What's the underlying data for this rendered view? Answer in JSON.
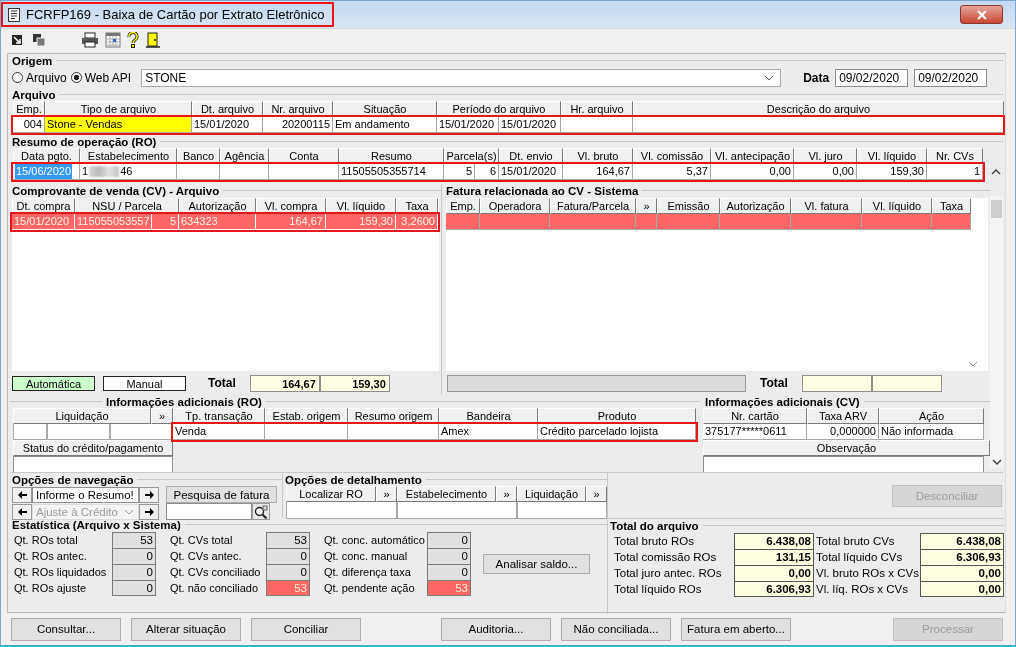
{
  "window": {
    "title": "FCRFP169 - Baixa de Cartão por Extrato Eletrônico",
    "annotated": true
  },
  "origem": {
    "legend": "Origem",
    "modes": [
      {
        "label": "Arquivo",
        "selected": false
      },
      {
        "label": "Web API",
        "selected": true
      }
    ],
    "operator": "STONE",
    "date_label": "Data",
    "date_from": "09/02/2020",
    "date_to": "09/02/2020"
  },
  "arquivo": {
    "legend": "Arquivo",
    "columns": [
      "Emp.",
      "Tipo de arquivo",
      "Dt. arquivo",
      "Nr. arquivo",
      "Situação",
      "Período do arquivo",
      "Hr. arquivo",
      "Descrição do arquivo"
    ],
    "rows": [
      {
        "annotated": true,
        "cells": [
          "004",
          {
            "text": "Stone - Vendas",
            "color": "#ffff00"
          },
          "15/01/2020",
          "20200115",
          "Em andamento",
          {
            "parts": [
              "15/01/2020",
              "15/01/2020"
            ]
          },
          null,
          null
        ]
      }
    ]
  },
  "resumo": {
    "legend": "Resumo de operação (RO)",
    "columns": [
      "Data pgto.",
      "Estabelecimento",
      "Banco",
      "Agência",
      "Conta",
      "Resumo",
      "Parcela(s)",
      "Dt. envio",
      "Vl. bruto",
      "Vl. comissão",
      "Vl. antecipação",
      "Vl. juro",
      "Vl. líquido",
      "Nr. CVs"
    ],
    "rows": [
      {
        "annotated": true,
        "cells": [
          {
            "text": "15/06/2020",
            "text_selected": true
          },
          {
            "kind": "redacted",
            "start": "1",
            "end": "46"
          },
          null,
          null,
          null,
          "11505505355714",
          {
            "parts": [
              "5",
              "6"
            ]
          },
          "15/01/2020",
          "164,67",
          "5,37",
          "0,00",
          "0,00",
          "159,30",
          "1"
        ]
      }
    ]
  },
  "comprovantes": {
    "legend": "Comprovante de venda (CV) - Arquivo",
    "columns": [
      "Dt. compra",
      "NSU / Parcela",
      "Autorização",
      "Vl. compra",
      "Vl. líquido",
      "Taxa"
    ],
    "rows": [
      {
        "annotated": true,
        "color": "#ff6666",
        "cells": [
          "15/01/2020",
          {
            "parts": [
              "115055053557",
              "5"
            ]
          },
          "634323",
          "164,67",
          "159,30",
          "3,2600"
        ]
      }
    ],
    "modes": [
      {
        "label": "Automática",
        "color": "#ccffcc"
      },
      {
        "label": "Manual",
        "color": "#ffffff"
      }
    ],
    "total_label": "Total",
    "totals": [
      "164,67",
      "159,30"
    ]
  },
  "faturas": {
    "legend": "Fatura relacionada ao CV - Sistema",
    "columns": [
      "Emp.",
      "Operadora",
      "Fatura/Parcela",
      "»",
      "Emissão",
      "Autorização",
      "Vl. fatura",
      "Vl. líquido",
      "Taxa"
    ],
    "rows": [
      {
        "annotated": false,
        "color": "#ff6666",
        "cells": [
          null,
          null,
          null,
          null,
          null,
          null,
          null,
          null,
          null
        ]
      }
    ],
    "total_label": "Total"
  },
  "info_ro": {
    "legend": "Informações adicionais (RO)",
    "liquidacao": "Liquidação",
    "more": "»",
    "status_label": "Status do crédito/pagamento",
    "columns": [
      "Tp. transação",
      "Estab. origem",
      "Resumo origem",
      "Bandeira",
      "Produto"
    ],
    "rows": [
      {
        "annotated": true,
        "cells": [
          "Venda",
          null,
          null,
          "Amex",
          "Crédito parcelado lojista"
        ]
      }
    ]
  },
  "info_cv": {
    "legend": "Informações adicionais (CV)",
    "columns": [
      "Nr. cartão",
      "Taxa ARV",
      "Ação"
    ],
    "rows": [
      {
        "cells": [
          "375177*****0611",
          "0,000000",
          "Não informada"
        ]
      }
    ],
    "observacao_label": "Observação"
  },
  "navegacao": {
    "legend": "Opções de navegação",
    "resumo_value": "Informe o Resumo!",
    "ajuste": "Ajuste à Crédito",
    "ajuste_disabled": true,
    "search_label": "Pesquisa de fatura"
  },
  "detalhamento": {
    "legend": "Opções de detalhamento",
    "columns": [
      {
        "label": "Localizar RO",
        "more": "»"
      },
      {
        "label": "Estabelecimento",
        "more": "»"
      },
      {
        "label": "Liquidação",
        "more": "»"
      }
    ]
  },
  "desconciliar": {
    "label": "Desconciliar",
    "disabled": true
  },
  "estatistica": {
    "legend": "Estatística (Arquivo x Sistema)",
    "columns": [
      [
        {
          "label": "Qt. ROs total",
          "value": "53",
          "alert": false
        },
        {
          "label": "Qt. ROs antec.",
          "value": "0",
          "alert": false
        },
        {
          "label": "Qt. ROs liquidados",
          "value": "0",
          "alert": false
        },
        {
          "label": "Qt. ROs ajuste",
          "value": "0",
          "alert": false
        }
      ],
      [
        {
          "label": "Qt. CVs total",
          "value": "53",
          "alert": false
        },
        {
          "label": "Qt. CVs antec.",
          "value": "0",
          "alert": false
        },
        {
          "label": "Qt. CVs conciliado",
          "value": "0",
          "alert": false
        },
        {
          "label": "Qt. não conciliado",
          "value": "53",
          "alert": true
        }
      ],
      [
        {
          "label": "Qt. conc. automático",
          "value": "0",
          "alert": false
        },
        {
          "label": "Qt. conc. manual",
          "value": "0",
          "alert": false
        },
        {
          "label": "Qt. diferença taxa",
          "value": "0",
          "alert": false
        },
        {
          "label": "Qt. pendente ação",
          "value": "53",
          "alert": true
        }
      ]
    ],
    "analyze_button": "Analisar saldo..."
  },
  "totais": {
    "legend": "Total do arquivo",
    "columns": [
      [
        {
          "label": "Total bruto ROs",
          "value": "6.438,08"
        },
        {
          "label": "Total comissão ROs",
          "value": "131,15"
        },
        {
          "label": "Total juro antec. ROs",
          "value": "0,00"
        },
        {
          "label": "Total líquido ROs",
          "value": "6.306,93"
        }
      ],
      [
        {
          "label": "Total bruto CVs",
          "value": "6.438,08"
        },
        {
          "label": "Total líquido CVs",
          "value": "6.306,93"
        },
        {
          "label": "Vl. bruto ROs x CVs",
          "value": "0,00"
        },
        {
          "label": "Vl. líq. ROs x CVs",
          "value": "0,00"
        }
      ]
    ]
  },
  "buttons": [
    [
      {
        "label": "Consultar...",
        "disabled": false
      },
      {
        "label": "Alterar situação",
        "disabled": false
      },
      {
        "label": "Conciliar",
        "disabled": false
      }
    ],
    [
      {
        "label": "Auditoria...",
        "disabled": false
      },
      {
        "label": "Não conciliada...",
        "disabled": false
      },
      {
        "label": "Fatura em aberto...",
        "disabled": false
      }
    ],
    [
      {
        "label": "Processar",
        "disabled": true
      }
    ]
  ]
}
